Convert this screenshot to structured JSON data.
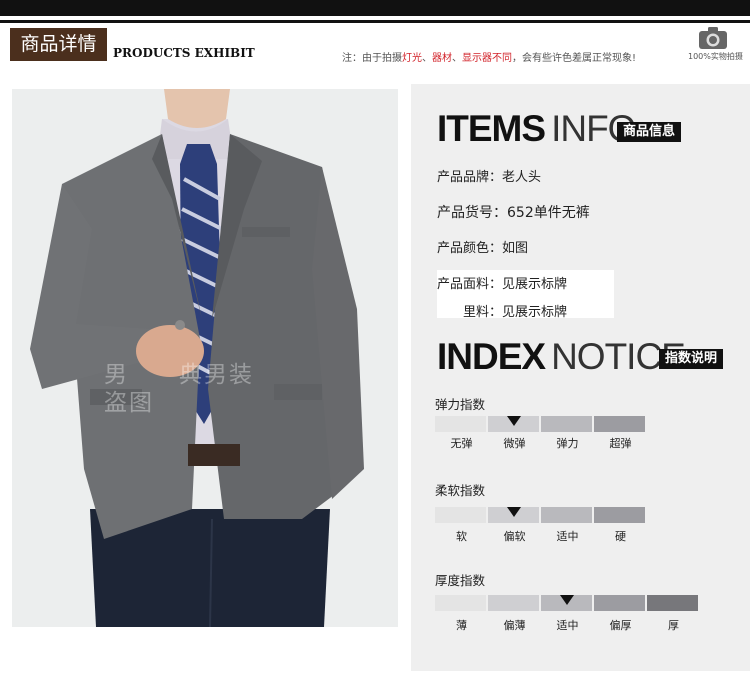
{
  "header": {
    "tag": "商品详情",
    "en": "PRODUCTS EXHIBIT",
    "notice_prefix": "注：由于拍摄",
    "notice_red1": "灯光",
    "notice_sep1": "、",
    "notice_red2": "器材",
    "notice_sep2": "、",
    "notice_red3": "显示器不同",
    "notice_suffix": "，会有些许色差属正常现象!",
    "camera_label": "100%实物拍摄",
    "camera_icon": "camera-icon"
  },
  "photo": {
    "watermark_line1": "男　　典男装",
    "watermark_line2": "盗图"
  },
  "items_info": {
    "title_bold": "ITEMS",
    "title_light": "INFO",
    "tag": "商品信息",
    "rows": [
      {
        "label": "产品品牌：",
        "value": "老人头"
      },
      {
        "label": "产品货号：",
        "value": "652单件无裤"
      },
      {
        "label": "产品颜色：",
        "value": "如图"
      },
      {
        "label": "产品面料：",
        "value": "见展示标牌"
      },
      {
        "label": "里料：",
        "value": "见展示标牌"
      }
    ]
  },
  "index_notice": {
    "title_bold": "INDEX",
    "title_light": "NOTICE",
    "tag": "指数说明",
    "scales": [
      {
        "title": "弹力指数",
        "levels": [
          "无弹",
          "微弹",
          "弹力",
          "超弹"
        ],
        "selected": 1
      },
      {
        "title": "柔软指数",
        "levels": [
          "软",
          "偏软",
          "适中",
          "硬"
        ],
        "selected": 1
      },
      {
        "title": "厚度指数",
        "levels": [
          "薄",
          "偏薄",
          "适中",
          "偏厚",
          "厚"
        ],
        "selected": 2
      }
    ],
    "colors": [
      "#e4e4e4",
      "#cfcfd2",
      "#b9b9bd",
      "#9c9ca1",
      "#77777b"
    ]
  }
}
